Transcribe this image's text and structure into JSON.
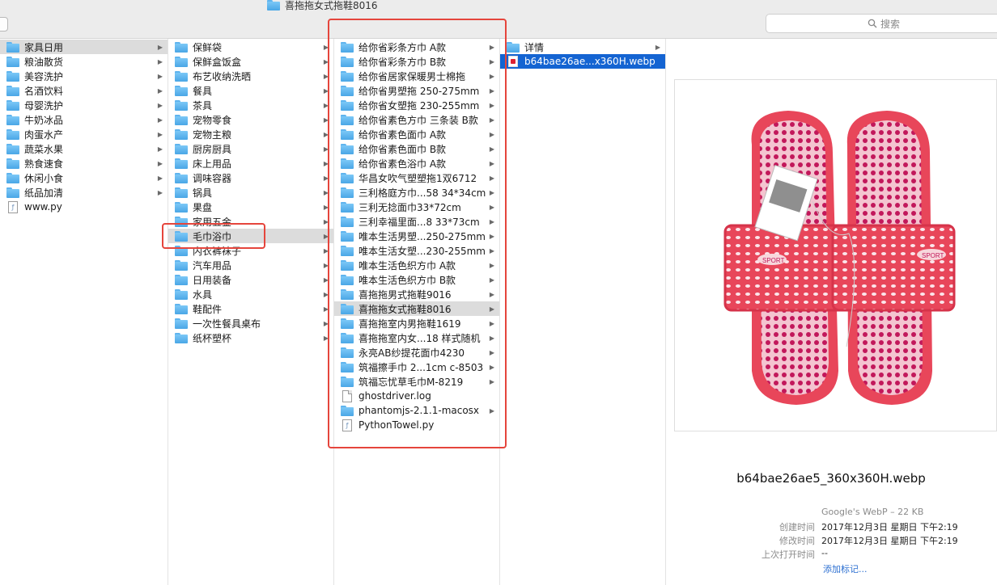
{
  "window": {
    "title": "喜拖拖女式拖鞋8016"
  },
  "search": {
    "placeholder": "搜索"
  },
  "column1": {
    "items": [
      {
        "label": "家具日用",
        "kind": "folder",
        "state": "selected"
      },
      {
        "label": "粮油散货",
        "kind": "folder"
      },
      {
        "label": "美容洗护",
        "kind": "folder"
      },
      {
        "label": "名酒饮料",
        "kind": "folder"
      },
      {
        "label": "母婴洗护",
        "kind": "folder"
      },
      {
        "label": "牛奶冰品",
        "kind": "folder"
      },
      {
        "label": "肉蛋水产",
        "kind": "folder"
      },
      {
        "label": "蔬菜水果",
        "kind": "folder"
      },
      {
        "label": "熟食速食",
        "kind": "folder"
      },
      {
        "label": "休闲小食",
        "kind": "folder"
      },
      {
        "label": "纸品加清",
        "kind": "folder"
      },
      {
        "label": "www.py",
        "kind": "py"
      }
    ]
  },
  "column2": {
    "items": [
      {
        "label": "保鲜袋",
        "kind": "folder"
      },
      {
        "label": "保鲜盒饭盒",
        "kind": "folder"
      },
      {
        "label": "布艺收纳洗晒",
        "kind": "folder"
      },
      {
        "label": "餐具",
        "kind": "folder"
      },
      {
        "label": "茶具",
        "kind": "folder"
      },
      {
        "label": "宠物零食",
        "kind": "folder"
      },
      {
        "label": "宠物主粮",
        "kind": "folder"
      },
      {
        "label": "厨房厨具",
        "kind": "folder"
      },
      {
        "label": "床上用品",
        "kind": "folder"
      },
      {
        "label": "调味容器",
        "kind": "folder"
      },
      {
        "label": "锅具",
        "kind": "folder"
      },
      {
        "label": "果盘",
        "kind": "folder"
      },
      {
        "label": "家用五金",
        "kind": "folder"
      },
      {
        "label": "毛巾浴巾",
        "kind": "folder",
        "state": "selected"
      },
      {
        "label": "内衣裤袜子",
        "kind": "folder"
      },
      {
        "label": "汽车用品",
        "kind": "folder"
      },
      {
        "label": "日用装备",
        "kind": "folder"
      },
      {
        "label": "水具",
        "kind": "folder"
      },
      {
        "label": "鞋配件",
        "kind": "folder"
      },
      {
        "label": "一次性餐具桌布",
        "kind": "folder"
      },
      {
        "label": "纸杯塑杯",
        "kind": "folder"
      }
    ]
  },
  "column3": {
    "items": [
      {
        "label": "给你省彩条方巾 A款",
        "kind": "folder"
      },
      {
        "label": "给你省彩条方巾 B款",
        "kind": "folder"
      },
      {
        "label": "给你省居家保暖男士棉拖",
        "kind": "folder"
      },
      {
        "label": "给你省男塑拖 250-275mm",
        "kind": "folder"
      },
      {
        "label": "给你省女塑拖 230-255mm",
        "kind": "folder"
      },
      {
        "label": "给你省素色方巾 三条装 B款",
        "kind": "folder"
      },
      {
        "label": "给你省素色面巾 A款",
        "kind": "folder"
      },
      {
        "label": "给你省素色面巾 B款",
        "kind": "folder"
      },
      {
        "label": "给你省素色浴巾 A款",
        "kind": "folder"
      },
      {
        "label": "华昌女吹气塑塑拖1双6712",
        "kind": "folder"
      },
      {
        "label": "三利格庭方巾...58 34*34cm",
        "kind": "folder"
      },
      {
        "label": "三利无捻面巾33*72cm",
        "kind": "folder"
      },
      {
        "label": "三利幸福里面...8 33*73cm",
        "kind": "folder"
      },
      {
        "label": "唯本生活男塑...250-275mm",
        "kind": "folder"
      },
      {
        "label": "唯本生活女塑...230-255mm",
        "kind": "folder"
      },
      {
        "label": "唯本生活色织方巾 A款",
        "kind": "folder"
      },
      {
        "label": "唯本生活色织方巾 B款",
        "kind": "folder"
      },
      {
        "label": "喜拖拖男式拖鞋9016",
        "kind": "folder"
      },
      {
        "label": "喜拖拖女式拖鞋8016",
        "kind": "folder",
        "state": "selected"
      },
      {
        "label": "喜拖拖室内男拖鞋1619",
        "kind": "folder"
      },
      {
        "label": "喜拖拖室内女...18 样式随机",
        "kind": "folder"
      },
      {
        "label": "永亮AB纱提花面巾4230",
        "kind": "folder"
      },
      {
        "label": "筑福擦手巾 2...1cm c-8503",
        "kind": "folder"
      },
      {
        "label": "筑福忘忧草毛巾M-8219",
        "kind": "folder"
      },
      {
        "label": "ghostdriver.log",
        "kind": "doc"
      },
      {
        "label": "phantomjs-2.1.1-macosx",
        "kind": "folder"
      },
      {
        "label": "PythonTowel.py",
        "kind": "py"
      }
    ]
  },
  "column4": {
    "items": [
      {
        "label": "详情",
        "kind": "folder"
      },
      {
        "label": "b64bae26ae...x360H.webp",
        "kind": "image",
        "state": "active"
      }
    ]
  },
  "preview": {
    "filename": "b64bae26ae5_360x360H.webp",
    "type_size": "Google's WebP – 22 KB",
    "created_label": "创建时间",
    "created_value": "2017年12月3日 星期日 下午2:19",
    "modified_label": "修改时间",
    "modified_value": "2017年12月3日 星期日 下午2:19",
    "opened_label": "上次打开时间",
    "opened_value": "--",
    "add_tags": "添加标记...",
    "image_text": "SPORT",
    "image_colors": {
      "slipper": "#e8465a",
      "insole": "#f3b7c6",
      "pattern": "#c2185b"
    }
  },
  "colors": {
    "selection_blue": "#1464d2",
    "selection_grey": "#dcdcdc",
    "annotation_red": "#e5453c"
  }
}
